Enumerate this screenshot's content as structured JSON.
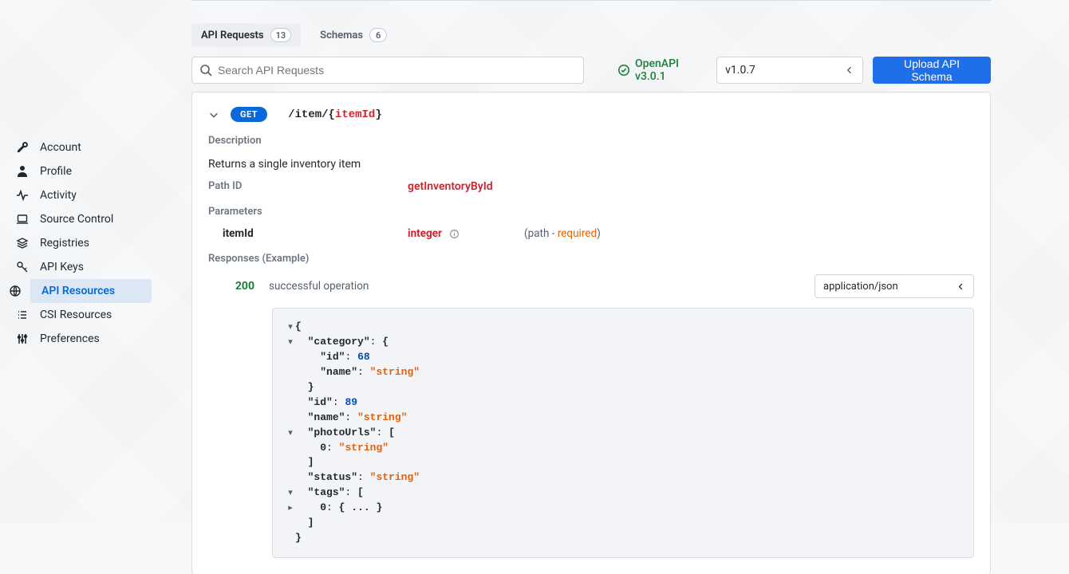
{
  "sidebar": {
    "items": [
      {
        "label": "Account",
        "icon": "wrench"
      },
      {
        "label": "Profile",
        "icon": "person"
      },
      {
        "label": "Activity",
        "icon": "pulse"
      },
      {
        "label": "Source Control",
        "icon": "laptop"
      },
      {
        "label": "Registries",
        "icon": "stack"
      },
      {
        "label": "API Keys",
        "icon": "key"
      },
      {
        "label": "API Resources",
        "icon": "globe"
      },
      {
        "label": "CSI Resources",
        "icon": "list"
      },
      {
        "label": "Preferences",
        "icon": "sliders"
      }
    ],
    "active_index": 6
  },
  "tabs": [
    {
      "label": "API Requests",
      "count": "13"
    },
    {
      "label": "Schemas",
      "count": "6"
    }
  ],
  "active_tab_index": 0,
  "search": {
    "placeholder": "Search API Requests"
  },
  "openapi": {
    "label": "OpenAPI v3.0.1",
    "status_color": "#1a7f37"
  },
  "version_select": {
    "value": "v1.0.7"
  },
  "upload_button": {
    "label": "Upload API Schema"
  },
  "endpoint": {
    "method": "GET",
    "path_prefix": "/item/{",
    "path_param": "itemId",
    "path_suffix": "}",
    "sections": {
      "description_label": "Description",
      "description_text": "Returns a single inventory item",
      "path_id_label": "Path ID",
      "path_id_value": "getInventoryById",
      "parameters_label": "Parameters",
      "param": {
        "name": "itemId",
        "type": "integer",
        "in_prefix": "(path - ",
        "required": "required",
        "in_suffix": ")"
      },
      "responses_label": "Responses (Example)",
      "response": {
        "code": "200",
        "description": "successful operation",
        "content_type": "application/json"
      }
    }
  },
  "json_example": {
    "lines": [
      {
        "caret": "v",
        "indent": 0,
        "parts": [
          {
            "t": "punc",
            "v": "{"
          }
        ]
      },
      {
        "caret": "v",
        "indent": 1,
        "parts": [
          {
            "t": "kc",
            "v": "\"category\""
          },
          {
            "t": "colon",
            "v": ":"
          },
          {
            "t": "space",
            "v": " "
          },
          {
            "t": "punc",
            "v": "{"
          }
        ]
      },
      {
        "caret": "",
        "indent": 2,
        "parts": [
          {
            "t": "kc",
            "v": "\"id\""
          },
          {
            "t": "colon",
            "v": ":"
          },
          {
            "t": "space",
            "v": " "
          },
          {
            "t": "num",
            "v": "68"
          }
        ]
      },
      {
        "caret": "",
        "indent": 2,
        "parts": [
          {
            "t": "kc",
            "v": "\"name\""
          },
          {
            "t": "colon",
            "v": ":"
          },
          {
            "t": "space",
            "v": " "
          },
          {
            "t": "str",
            "v": "\"string\""
          }
        ]
      },
      {
        "caret": "",
        "indent": 1,
        "parts": [
          {
            "t": "punc",
            "v": "}"
          }
        ]
      },
      {
        "caret": "",
        "indent": 1,
        "parts": [
          {
            "t": "kc",
            "v": "\"id\""
          },
          {
            "t": "colon",
            "v": ":"
          },
          {
            "t": "space",
            "v": " "
          },
          {
            "t": "num",
            "v": "89"
          }
        ]
      },
      {
        "caret": "",
        "indent": 1,
        "parts": [
          {
            "t": "kc",
            "v": "\"name\""
          },
          {
            "t": "colon",
            "v": ":"
          },
          {
            "t": "space",
            "v": " "
          },
          {
            "t": "str",
            "v": "\"string\""
          }
        ]
      },
      {
        "caret": "v",
        "indent": 1,
        "parts": [
          {
            "t": "kc",
            "v": "\"photoUrls\""
          },
          {
            "t": "colon",
            "v": ":"
          },
          {
            "t": "space",
            "v": " "
          },
          {
            "t": "punc",
            "v": "["
          }
        ]
      },
      {
        "caret": "",
        "indent": 2,
        "parts": [
          {
            "t": "kc",
            "v": "0"
          },
          {
            "t": "colon",
            "v": ":"
          },
          {
            "t": "space",
            "v": " "
          },
          {
            "t": "str",
            "v": "\"string\""
          }
        ]
      },
      {
        "caret": "",
        "indent": 1,
        "parts": [
          {
            "t": "punc",
            "v": "]"
          }
        ]
      },
      {
        "caret": "",
        "indent": 1,
        "parts": [
          {
            "t": "kc",
            "v": "\"status\""
          },
          {
            "t": "colon",
            "v": ":"
          },
          {
            "t": "space",
            "v": " "
          },
          {
            "t": "str",
            "v": "\"string\""
          }
        ]
      },
      {
        "caret": "v",
        "indent": 1,
        "parts": [
          {
            "t": "kc",
            "v": "\"tags\""
          },
          {
            "t": "colon",
            "v": ":"
          },
          {
            "t": "space",
            "v": " "
          },
          {
            "t": "punc",
            "v": "["
          }
        ]
      },
      {
        "caret": ">",
        "indent": 2,
        "parts": [
          {
            "t": "kc",
            "v": "0"
          },
          {
            "t": "colon",
            "v": ":"
          },
          {
            "t": "space",
            "v": " "
          },
          {
            "t": "punc",
            "v": "{"
          },
          {
            "t": "space",
            "v": " "
          },
          {
            "t": "punc",
            "v": "..."
          },
          {
            "t": "space",
            "v": " "
          },
          {
            "t": "punc",
            "v": "}"
          }
        ]
      },
      {
        "caret": "",
        "indent": 1,
        "parts": [
          {
            "t": "punc",
            "v": "]"
          }
        ]
      },
      {
        "caret": "",
        "indent": 0,
        "parts": [
          {
            "t": "punc",
            "v": "}"
          }
        ]
      }
    ]
  }
}
